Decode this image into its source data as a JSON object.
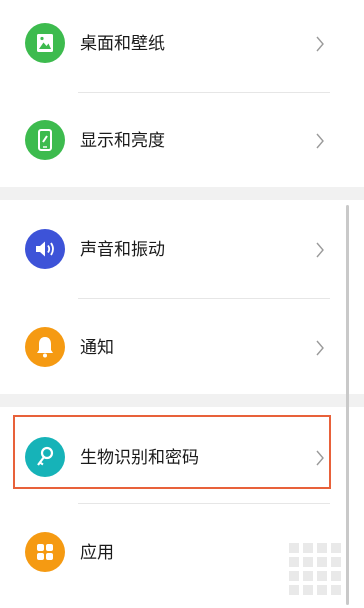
{
  "settings": {
    "items": [
      {
        "label": "桌面和壁纸",
        "icon": "wallpaper-image-icon",
        "color": "#3dbb4e"
      },
      {
        "label": "显示和亮度",
        "icon": "phone-brightness-icon",
        "color": "#3dbb4e"
      },
      {
        "label": "声音和振动",
        "icon": "speaker-icon",
        "color": "#3d53d8"
      },
      {
        "label": "通知",
        "icon": "bell-icon",
        "color": "#f59a12"
      },
      {
        "label": "生物识别和密码",
        "icon": "key-icon",
        "color": "#16b3b8"
      },
      {
        "label": "应用",
        "icon": "apps-grid-icon",
        "color": "#f59a12"
      }
    ],
    "chevron_icon": "chevron-right-icon",
    "highlighted_item": "生物识别和密码",
    "highlight_color": "#e8613a"
  }
}
